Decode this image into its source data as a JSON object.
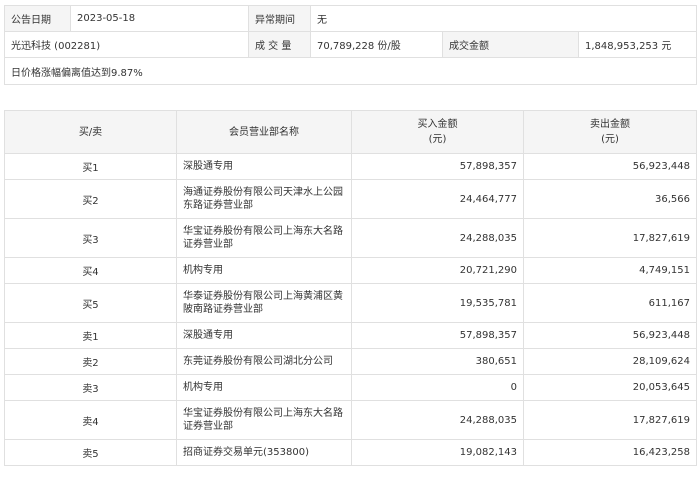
{
  "info": {
    "date_label": "公告日期",
    "date_value": "2023-05-18",
    "period_label": "异常期间",
    "period_value": "无",
    "stock_name": "光迅科技 (002281)",
    "volume_label": "成 交 量",
    "volume_value": "70,789,228 份/股",
    "amount_label": "成交金额",
    "amount_value": "1,848,953,253 元",
    "reason": "日价格涨幅偏离值达到9.87%"
  },
  "table": {
    "headers": {
      "side": "买/卖",
      "branch": "会员营业部名称",
      "buy": "买入金额",
      "buy_unit": "(元)",
      "sell": "卖出金额",
      "sell_unit": "(元)"
    },
    "rows": [
      {
        "side": "买1",
        "branch": "深股通专用",
        "buy": "57,898,357",
        "sell": "56,923,448"
      },
      {
        "side": "买2",
        "branch": "海通证券股份有限公司天津水上公园东路证券营业部",
        "buy": "24,464,777",
        "sell": "36,566"
      },
      {
        "side": "买3",
        "branch": "华宝证券股份有限公司上海东大名路证券营业部",
        "buy": "24,288,035",
        "sell": "17,827,619"
      },
      {
        "side": "买4",
        "branch": "机构专用",
        "buy": "20,721,290",
        "sell": "4,749,151"
      },
      {
        "side": "买5",
        "branch": "华泰证券股份有限公司上海黄浦区黄陂南路证券营业部",
        "buy": "19,535,781",
        "sell": "611,167"
      },
      {
        "side": "卖1",
        "branch": "深股通专用",
        "buy": "57,898,357",
        "sell": "56,923,448"
      },
      {
        "side": "卖2",
        "branch": "东莞证券股份有限公司湖北分公司",
        "buy": "380,651",
        "sell": "28,109,624"
      },
      {
        "side": "卖3",
        "branch": "机构专用",
        "buy": "0",
        "sell": "20,053,645"
      },
      {
        "side": "卖4",
        "branch": "华宝证券股份有限公司上海东大名路证券营业部",
        "buy": "24,288,035",
        "sell": "17,827,619"
      },
      {
        "side": "卖5",
        "branch": "招商证券交易单元(353800)",
        "buy": "19,082,143",
        "sell": "16,423,258"
      }
    ]
  }
}
